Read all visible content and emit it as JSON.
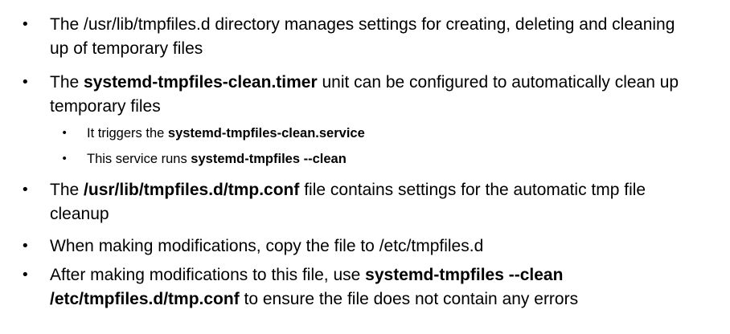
{
  "bullet_glyph": "•",
  "items": [
    {
      "parts": [
        "The /usr/lib/tmpfiles.d directory manages settings for creating, deleting and cleaning up of temporary files"
      ]
    },
    {
      "parts": [
        "The ",
        "systemd-tmpfiles-clean.timer",
        " unit can be configured to automatically clean up temporary files"
      ],
      "sub": [
        {
          "parts": [
            "It triggers the ",
            "systemd-tmpfiles-clean.service"
          ]
        },
        {
          "parts": [
            "This service runs ",
            "systemd-tmpfiles --clean"
          ]
        }
      ]
    },
    {
      "parts": [
        "The ",
        "/usr/lib/tmpfiles.d/tmp.conf",
        " file contains settings for the automatic tmp file cleanup"
      ]
    },
    {
      "parts": [
        "When making modifications, copy the file to /etc/tmpfiles.d"
      ]
    },
    {
      "parts": [
        "After making modifications to this file, use ",
        "systemd-tmpfiles --clean /etc/tmpfiles.d/tmp.conf",
        " to ensure the file does not contain any errors"
      ]
    }
  ]
}
